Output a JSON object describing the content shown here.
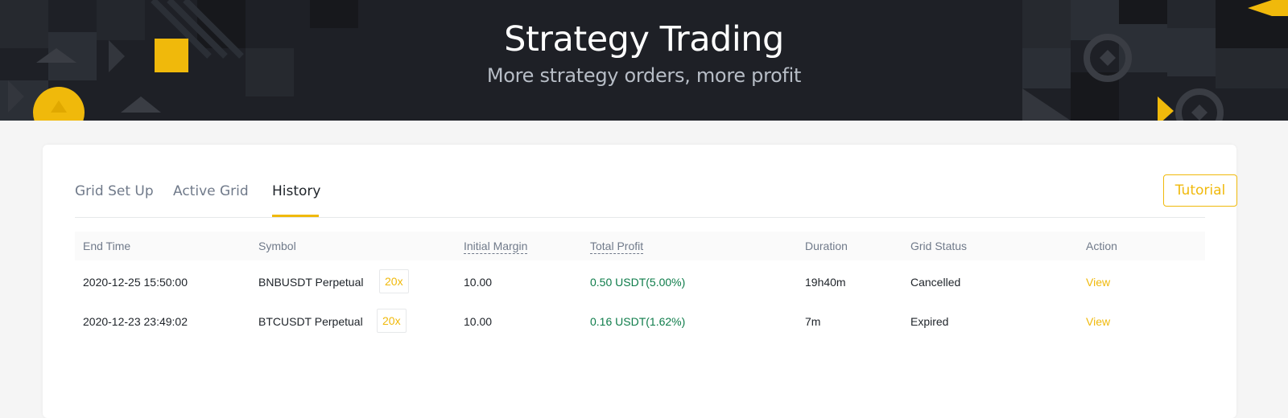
{
  "hero": {
    "title": "Strategy Trading",
    "subtitle": "More strategy orders, more profit"
  },
  "tabs": [
    {
      "label": "Grid Set Up",
      "active": false
    },
    {
      "label": "Active Grid",
      "active": false
    },
    {
      "label": "History",
      "active": true
    }
  ],
  "tutorial_label": "Tutorial",
  "table": {
    "headers": [
      "End Time",
      "Symbol",
      "Initial Margin",
      "Total Profit",
      "Duration",
      "Grid Status",
      "Action"
    ],
    "rows": [
      {
        "end_time": "2020-12-25 15:50:00",
        "symbol": "BNBUSDT Perpetual",
        "leverage": "20x",
        "initial_margin": "10.00",
        "total_profit": "0.50 USDT(5.00%)",
        "duration": "19h40m",
        "status": "Cancelled",
        "action": "View"
      },
      {
        "end_time": "2020-12-23 23:49:02",
        "symbol": "BTCUSDT Perpetual",
        "leverage": "20x",
        "initial_margin": "10.00",
        "total_profit": "0.16 USDT(1.62%)",
        "duration": "7m",
        "status": "Expired",
        "action": "View"
      }
    ]
  },
  "colors": {
    "accent": "#f0b90b",
    "profit": "#0e7c4a",
    "hero_bg": "#1e2026"
  }
}
